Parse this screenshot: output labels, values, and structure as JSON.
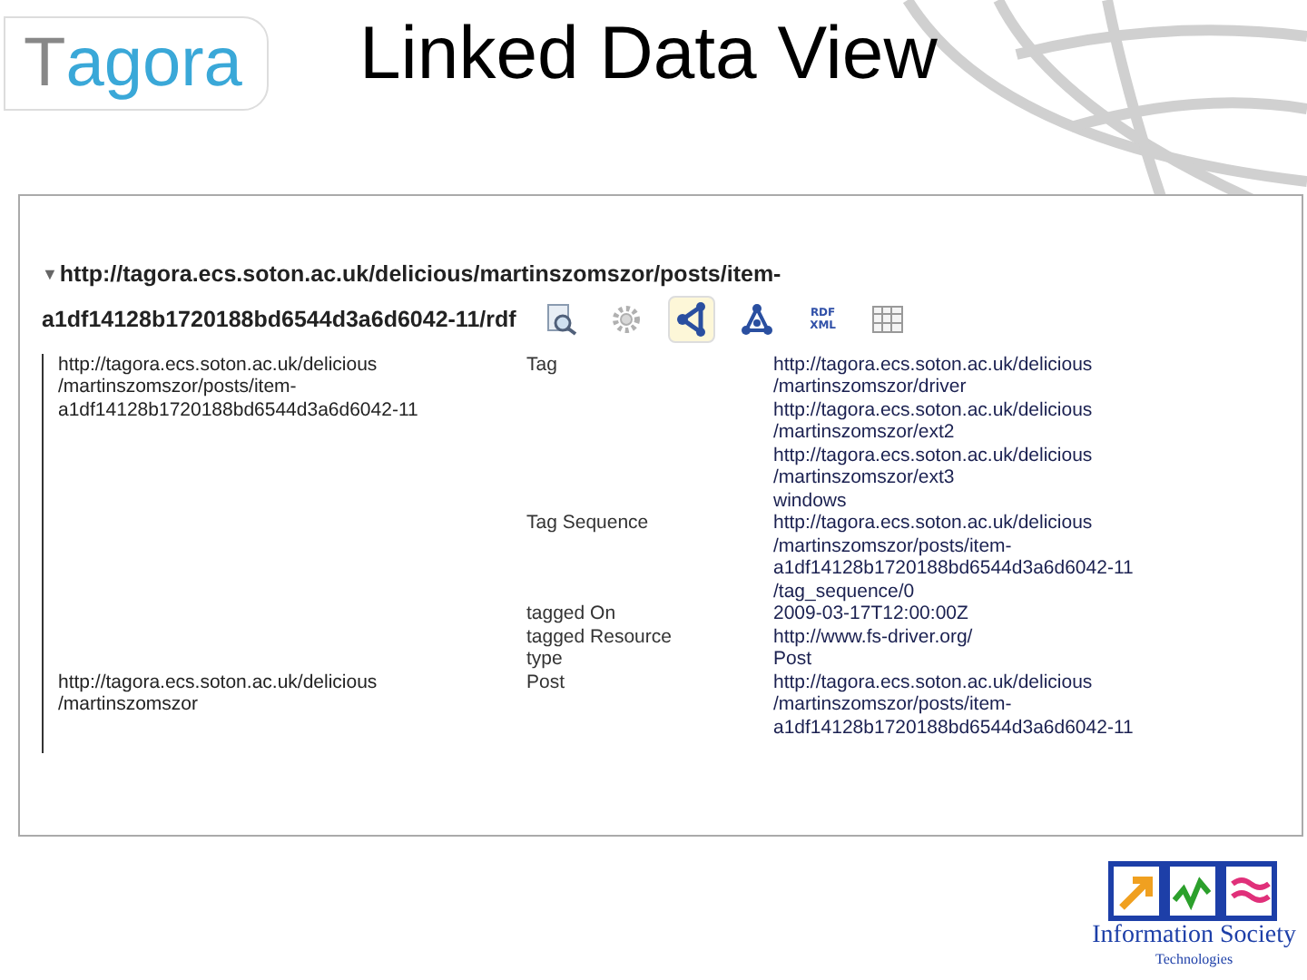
{
  "logo": {
    "text": "Tagora"
  },
  "title": "Linked Data View",
  "viewer": {
    "heading_line_1": "http://tagora.ecs.soton.ac.uk/delicious/martinszomszor/posts/item-",
    "heading_line_2": "a1df14128b1720188bd6544d3a6d6042-11/rdf",
    "expander": "▼",
    "expanded": true,
    "toolbar": [
      {
        "kind": "inspect",
        "selected": false
      },
      {
        "kind": "settings",
        "selected": false
      },
      {
        "kind": "graph",
        "selected": true
      },
      {
        "kind": "triangle",
        "selected": false
      },
      {
        "kind": "rdf",
        "label": "RDF\nXML",
        "selected": false
      },
      {
        "kind": "table",
        "selected": false
      }
    ],
    "subjects": [
      {
        "uri": "http://tagora.ecs.soton.ac.uk/delicious\n/martinszomszor/posts/item-\na1df14128b1720188bd6544d3a6d6042-11",
        "properties": [
          {
            "name": "Tag",
            "values": [
              "http://tagora.ecs.soton.ac.uk/delicious\n/martinszomszor/driver",
              "http://tagora.ecs.soton.ac.uk/delicious\n/martinszomszor/ext2",
              "http://tagora.ecs.soton.ac.uk/delicious\n/martinszomszor/ext3",
              "windows"
            ]
          },
          {
            "name": "Tag Sequence",
            "values": [
              "http://tagora.ecs.soton.ac.uk/delicious\n/martinszomszor/posts/item-\na1df14128b1720188bd6544d3a6d6042-11\n/tag_sequence/0"
            ]
          },
          {
            "name": "tagged On",
            "values": [
              "2009-03-17T12:00:00Z"
            ]
          },
          {
            "name": "tagged Resource",
            "values": [
              "http://www.fs-driver.org/"
            ]
          },
          {
            "name": "type",
            "values": [
              "Post"
            ]
          }
        ]
      },
      {
        "uri": "http://tagora.ecs.soton.ac.uk/delicious\n/martinszomszor",
        "properties": [
          {
            "name": "Post",
            "values": [
              "http://tagora.ecs.soton.ac.uk/delicious\n/martinszomszor/posts/item-\na1df14128b1720188bd6544d3a6d6042-11"
            ]
          }
        ]
      }
    ]
  },
  "footer_logo": {
    "line_1": "Information Society",
    "line_2": "Technologies"
  }
}
